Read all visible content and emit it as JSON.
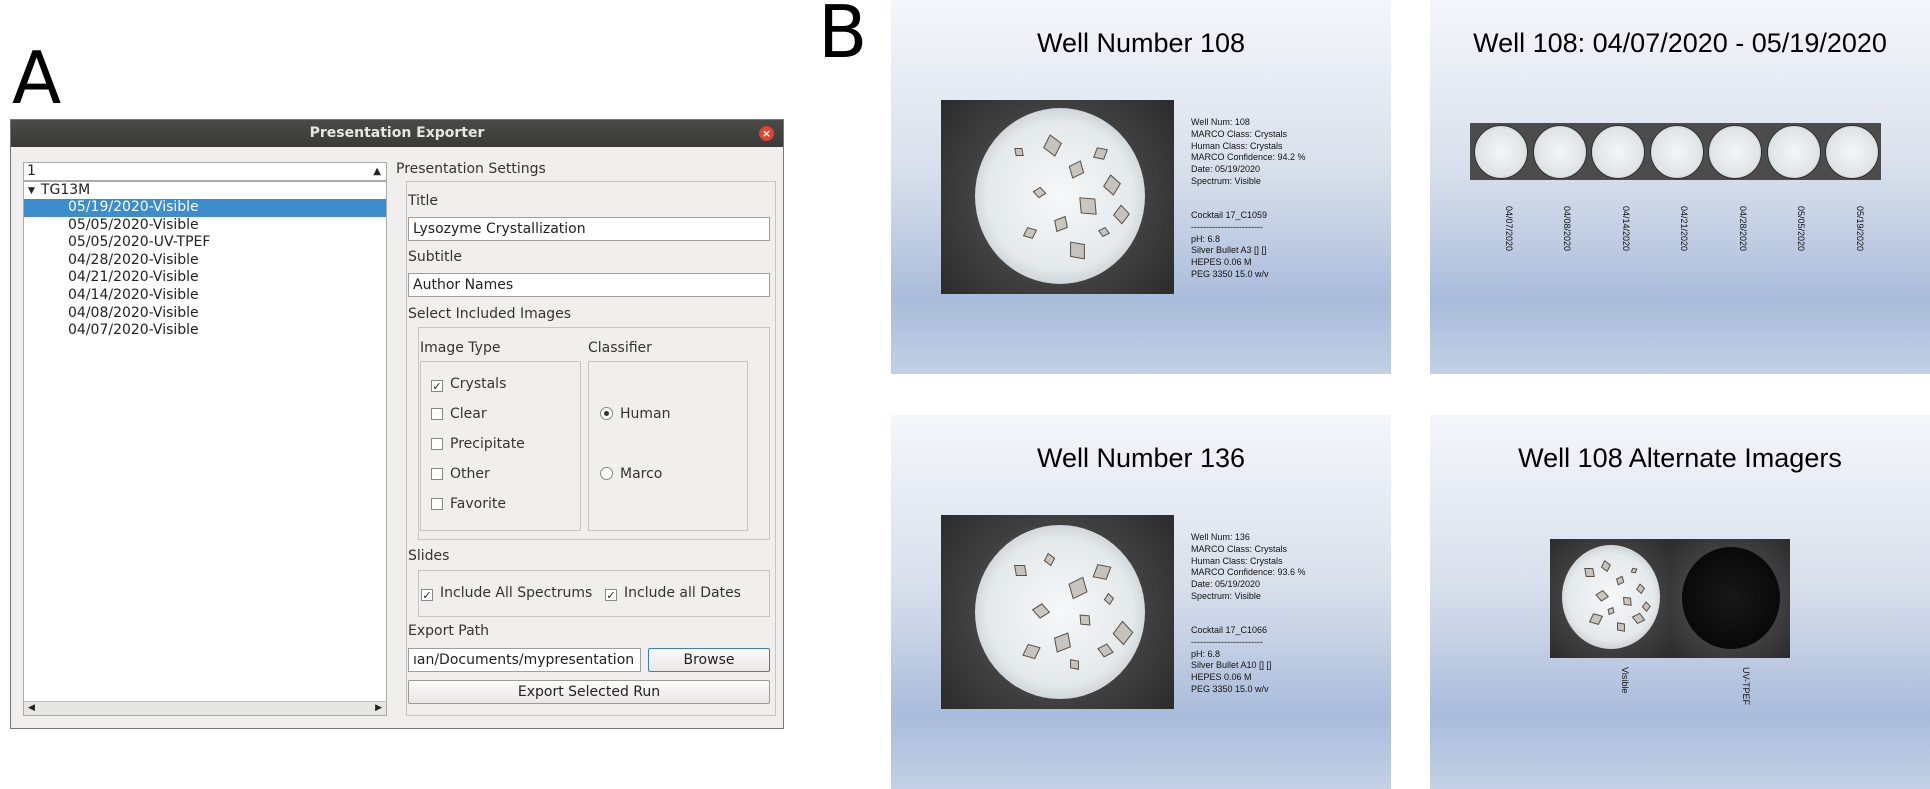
{
  "panel_letters": {
    "a": "A",
    "b": "B"
  },
  "dialog": {
    "title": "Presentation Exporter",
    "combo_value": "1",
    "tree": {
      "root": "TG13M",
      "items": [
        "05/19/2020-Visible",
        "05/05/2020-Visible",
        "05/05/2020-UV-TPEF",
        "04/28/2020-Visible",
        "04/21/2020-Visible",
        "04/14/2020-Visible",
        "04/08/2020-Visible",
        "04/07/2020-Visible"
      ],
      "selected_index": 0
    },
    "settings": {
      "header": "Presentation Settings",
      "title_label": "Title",
      "title_value": "Lysozyme Crystallization",
      "subtitle_label": "Subtitle",
      "subtitle_value": "Author Names",
      "select_images_label": "Select Included Images",
      "image_type_label": "Image Type",
      "image_types": [
        {
          "label": "Crystals",
          "checked": true
        },
        {
          "label": "Clear",
          "checked": false
        },
        {
          "label": "Precipitate",
          "checked": false
        },
        {
          "label": "Other",
          "checked": false
        },
        {
          "label": "Favorite",
          "checked": false
        }
      ],
      "classifier_label": "Classifier",
      "classifiers": [
        {
          "label": "Human",
          "selected": true
        },
        {
          "label": "Marco",
          "selected": false
        }
      ],
      "slides_label": "Slides",
      "include_all_spectrums": "Include All Spectrums",
      "include_all_dates": "Include all Dates",
      "export_path_label": "Export Path",
      "export_path_value": "ıan/Documents/mypresentation",
      "browse_label": "Browse",
      "export_label": "Export Selected Run"
    }
  },
  "slides": {
    "well108": {
      "title": "Well Number 108",
      "info": [
        "Well Num: 108",
        "MARCO Class: Crystals",
        "Human Class: Crystals",
        "MARCO Confidence: 94.2 %",
        "Date: 05/19/2020",
        "Spectrum: Visible"
      ],
      "cocktail": [
        "Cocktail 17_C1059",
        "------------------------",
        "pH: 6.8",
        "Silver Bullet  A3 [] []",
        "HEPES 0.06 M",
        "PEG 3350 15.0 w/v"
      ]
    },
    "timeline": {
      "title": "Well 108: 04/07/2020 - 05/19/2020",
      "dates": [
        "04/07/2020",
        "04/08/2020",
        "04/14/2020",
        "04/21/2020",
        "04/28/2020",
        "05/05/2020",
        "05/19/2020"
      ]
    },
    "well136": {
      "title": "Well Number 136",
      "info": [
        "Well Num: 136",
        "MARCO Class: Crystals",
        "Human Class: Crystals",
        "MARCO Confidence: 93.6 %",
        "Date: 05/19/2020",
        "Spectrum: Visible"
      ],
      "cocktail": [
        "Cocktail 17_C1066",
        "------------------------",
        "pH: 6.8",
        "Silver Bullet  A10 [] []",
        "HEPES 0.06 M",
        "PEG 3350 15.0 w/v"
      ]
    },
    "alternate": {
      "title": "Well 108 Alternate Imagers",
      "labels": [
        "Visible",
        "UV-TPEF"
      ]
    }
  }
}
